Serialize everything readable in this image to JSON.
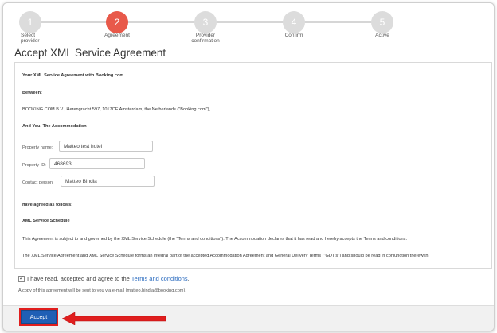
{
  "stepper": {
    "steps": [
      {
        "number": "1",
        "label_line1": "Select",
        "label_line2": "provider"
      },
      {
        "number": "2",
        "label_line1": "Agreement",
        "label_line2": ""
      },
      {
        "number": "3",
        "label_line1": "Provider",
        "label_line2": "confirmation"
      },
      {
        "number": "4",
        "label_line1": "Confirm",
        "label_line2": ""
      },
      {
        "number": "5",
        "label_line1": "Active",
        "label_line2": ""
      }
    ],
    "active_step": 2
  },
  "page": {
    "title": "Accept XML Service Agreement"
  },
  "agreement": {
    "heading": "Your XML Service Agreement with Booking.com",
    "between_label": "Between:",
    "party_booking": "BOOKING.COM B.V., Herengracht 597, 1017CE Amsterdam, the Netherlands (\"Booking.com\"),",
    "and_you": "And You, The Accommodation",
    "property_name_label": "Property name:",
    "property_name_value": "Matteo test hotel",
    "property_id_label": "Property ID:",
    "property_id_value": "468693",
    "contact_person_label": "Contact person:",
    "contact_person_value": "Matteo Bindia",
    "agreed_label": "have agreed as follows:",
    "schedule_heading": "XML Service Schedule",
    "para1": "This Agreement is subject to and governed by the XML Service Schedule (the \"Terms and conditions\"). The Accommodation declares that it has read and hereby accepts the Terms and conditions.",
    "para2": "The XML Service Agreement and XML Service Schedule forms an integral part of the accepted Accommodation Agreement and General Delivery Terms (\"GDT's\") and should be read in conjunction therewith."
  },
  "consent": {
    "checked": true,
    "text_before": "I have read, accepted and agree to the ",
    "link_text": "Terms and conditions",
    "text_after": ".",
    "copy_note": "A copy of this agreement will be sent to you via e-mail (matteo.bindia@booking.com)."
  },
  "footer": {
    "accept_label": "Accept"
  },
  "colors": {
    "active_step": "#e8594a",
    "inactive_step": "#dcdcdc",
    "accept_button": "#1f5fb5",
    "highlight": "#e01e1e",
    "link": "#2a6bbf"
  }
}
